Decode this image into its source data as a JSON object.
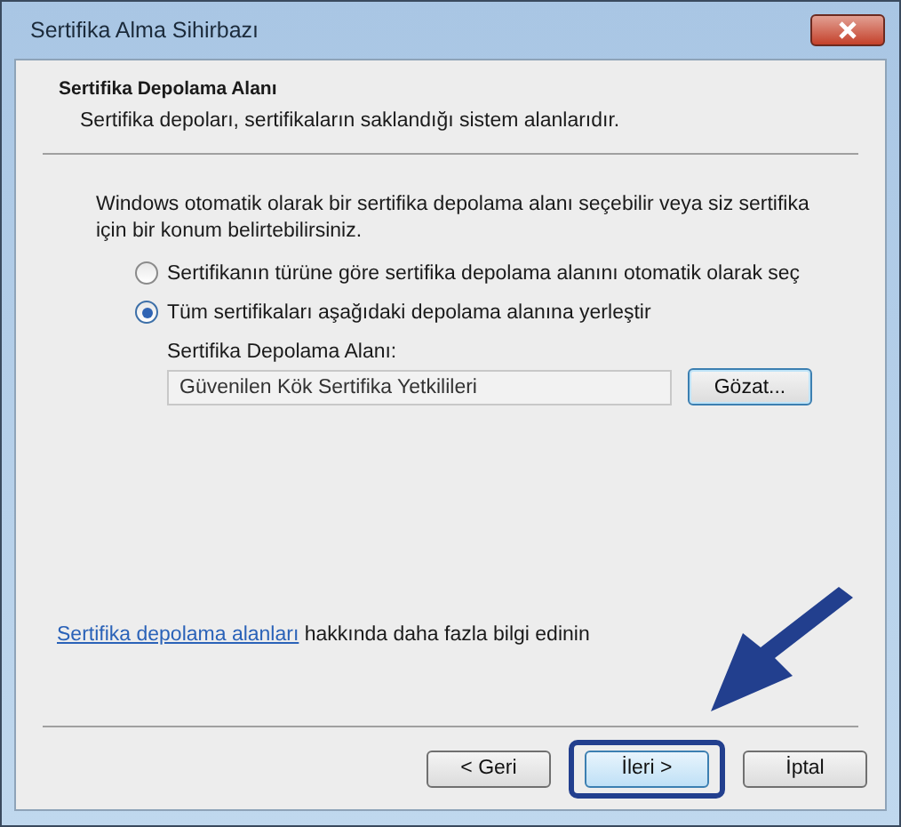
{
  "window": {
    "title": "Sertifika Alma Sihirbazı"
  },
  "header": {
    "title": "Sertifika Depolama Alanı",
    "subtitle": "Sertifika depoları, sertifikaların saklandığı sistem alanlarıdır."
  },
  "intro": "Windows otomatik olarak bir sertifika depolama alanı seçebilir veya siz sertifika için bir konum belirtebilirsiniz.",
  "options": [
    {
      "label": "Sertifikanın türüne göre sertifika depolama alanını otomatik olarak seç",
      "selected": false
    },
    {
      "label": "Tüm sertifikaları aşağıdaki depolama alanına yerleştir",
      "selected": true
    }
  ],
  "store": {
    "label": "Sertifika Depolama Alanı:",
    "value": "Güvenilen Kök Sertifika Yetkilileri",
    "browse": "Gözat..."
  },
  "help": {
    "link": "Sertifika depolama alanları",
    "text": "hakkında daha fazla bilgi edinin"
  },
  "buttons": [
    {
      "label": "< Geri",
      "highlighted": false
    },
    {
      "label": "İleri >",
      "highlighted": true
    },
    {
      "label": "İptal",
      "highlighted": false
    }
  ]
}
